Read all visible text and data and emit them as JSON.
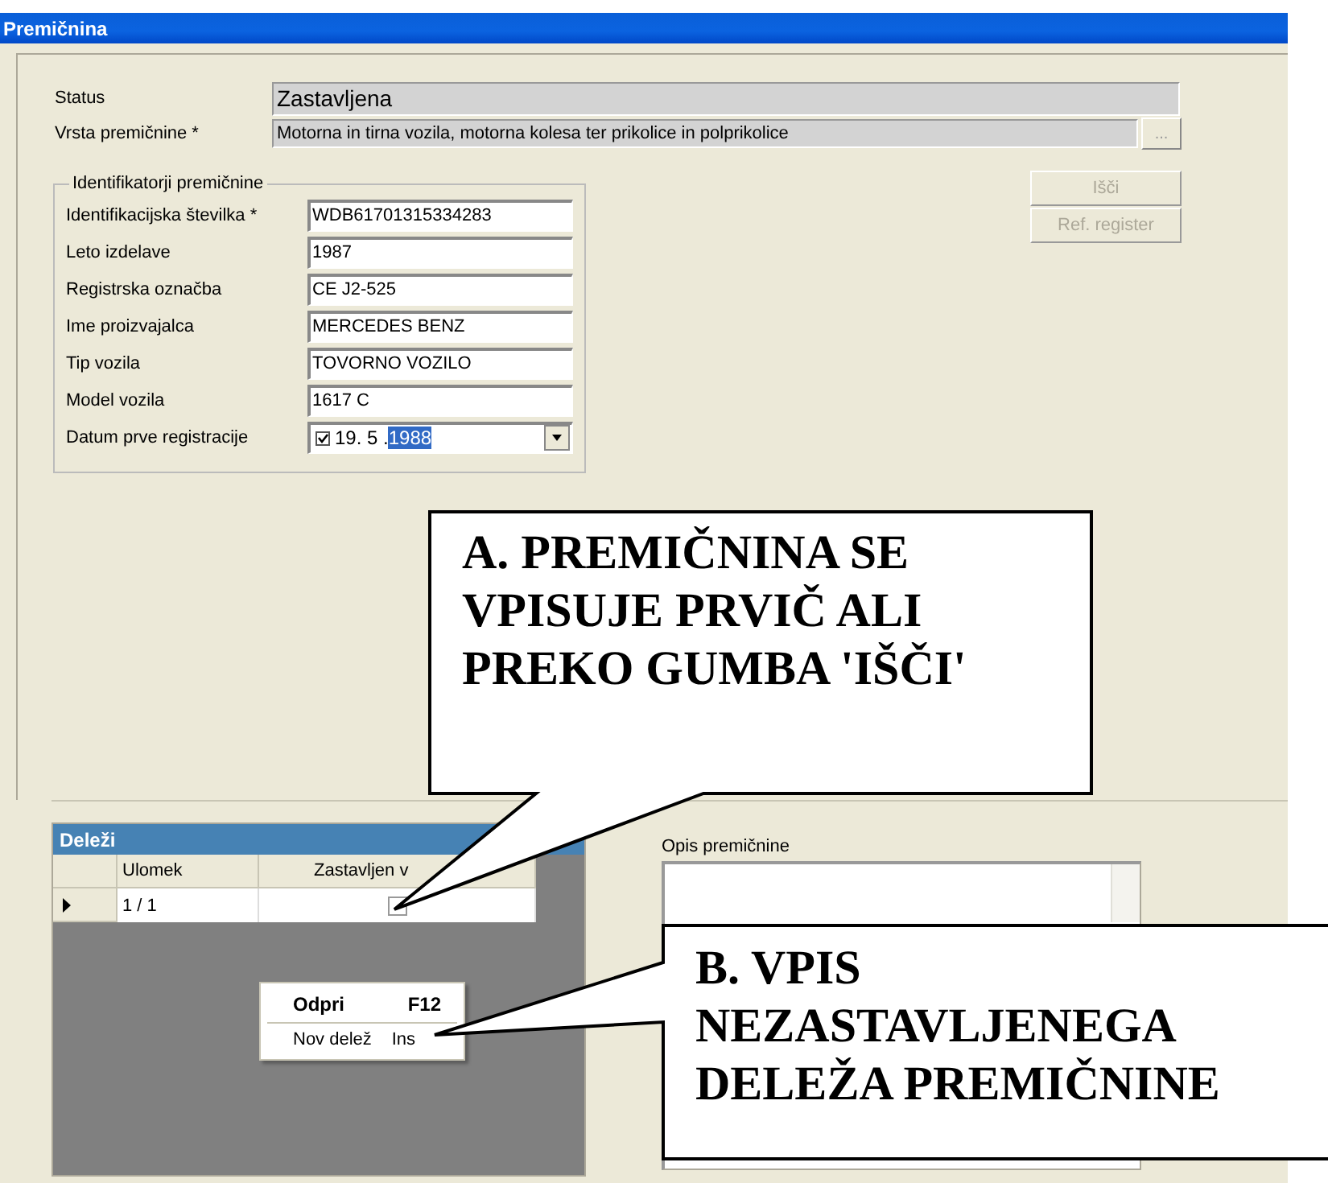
{
  "window": {
    "title": "Premičnina"
  },
  "status": {
    "label": "Status",
    "value": "Zastavljena"
  },
  "type": {
    "label": "Vrsta premičnine *",
    "value": "Motorna in tirna vozila, motorna kolesa ter prikolice in polprikolice",
    "button": "..."
  },
  "identifiers": {
    "legend": "Identifikatorji premičnine",
    "fields": [
      {
        "label": "Identifikacijska številka *",
        "value": "WDB61701315334283"
      },
      {
        "label": "Leto izdelave",
        "value": "1987"
      },
      {
        "label": "Registrska označba",
        "value": "CE J2-525"
      },
      {
        "label": "Ime proizvajalca",
        "value": "MERCEDES BENZ"
      },
      {
        "label": "Tip vozila",
        "value": "TOVORNO VOZILO"
      },
      {
        "label": "Model vozila",
        "value": "1617 C"
      }
    ],
    "date": {
      "label": "Datum prve registracije",
      "checked": true,
      "day_month": "19. 5 .",
      "year": "1988",
      "year_selected": true
    }
  },
  "buttons": [
    {
      "label": "Išči",
      "disabled": true
    },
    {
      "label": "Ref. register",
      "disabled": true
    }
  ],
  "shares": {
    "title": "Deleži",
    "columns": [
      "Ulomek",
      "Zastavljen v"
    ],
    "rows": [
      {
        "fraction": "1 / 1",
        "pledged": false,
        "selected": true
      }
    ]
  },
  "context_menu": [
    {
      "label": "Odpri",
      "shortcut": "F12",
      "bold": true
    },
    {
      "label": "Nov delež",
      "shortcut": "Ins",
      "bold": false
    }
  ],
  "description": {
    "label": "Opis premičnine"
  },
  "callouts": [
    {
      "text": "A. PREMIČNINA SE\nVPISUJE PRVIČ ALI\nPREKO GUMBA 'IŠČI'"
    },
    {
      "text": "B. VPIS\nNEZASTAVLJENEGA\nDELEŽA PREMIČNINE"
    }
  ]
}
